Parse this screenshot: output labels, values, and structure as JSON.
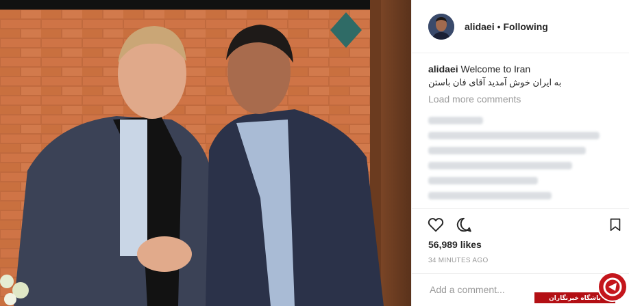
{
  "post": {
    "username": "alidaei",
    "separator": "•",
    "follow_label": "Following",
    "caption_user": "alidaei",
    "caption_en": "Welcome to Iran",
    "caption_fa": "به ایران خوش آمدید آقای فان باستن",
    "load_more": "Load more comments",
    "likes": "56,989 likes",
    "time": "34 MINUTES AGO",
    "comment_placeholder": "Add a comment..."
  },
  "watermark": {
    "text": "باشگاه خبرنگاران"
  },
  "icons": [
    "heart-icon",
    "comment-icon",
    "bookmark-icon"
  ],
  "colors": {
    "text": "#262626",
    "muted": "#999999",
    "watermark_red": "#b30f14"
  }
}
